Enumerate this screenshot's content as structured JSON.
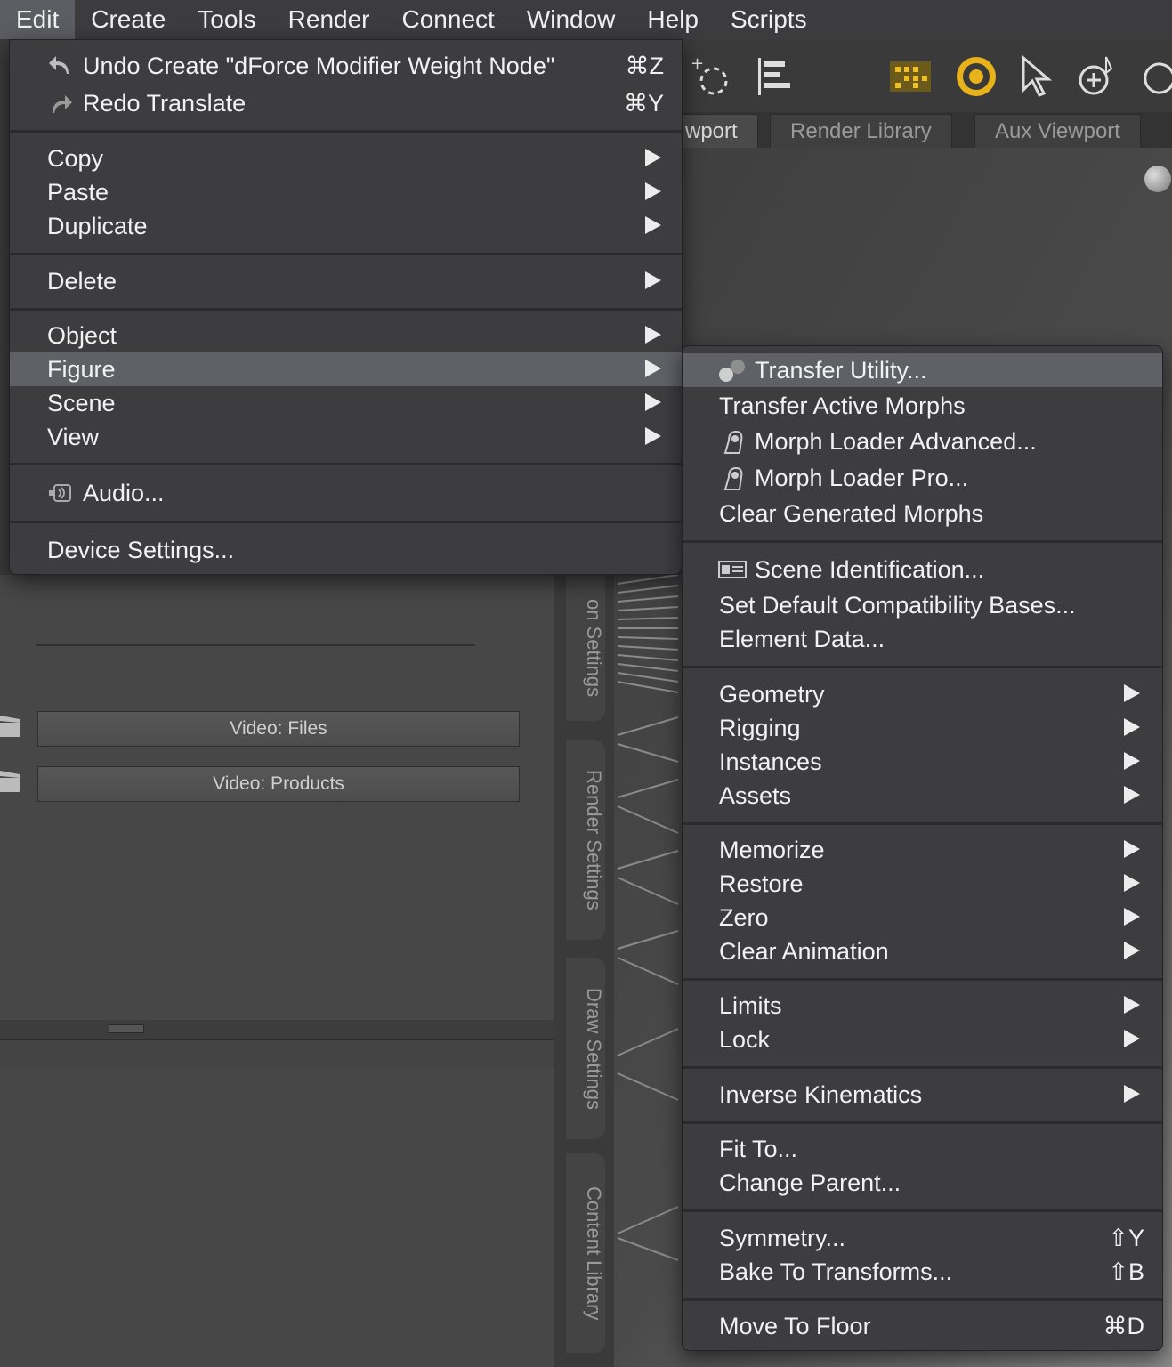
{
  "menubar": {
    "items": [
      "Edit",
      "Create",
      "Tools",
      "Render",
      "Connect",
      "Window",
      "Help",
      "Scripts"
    ],
    "active": "Edit"
  },
  "tabs": {
    "partial": "wport",
    "render_library": "Render Library",
    "aux_viewport": "Aux Viewport"
  },
  "left_panel": {
    "video_files": "Video: Files",
    "video_products": "Video:  Products"
  },
  "side_tabs": {
    "partial": "on Settings",
    "render_settings": "Render Settings",
    "draw_settings": "Draw Settings",
    "content_library": "Content Library"
  },
  "edit_menu": {
    "undo": {
      "label": "Undo Create \"dForce Modifier Weight Node\"",
      "shortcut": "⌘Z"
    },
    "redo": {
      "label": "Redo Translate",
      "shortcut": "⌘Y"
    },
    "copy": "Copy",
    "paste": "Paste",
    "duplicate": "Duplicate",
    "delete": "Delete",
    "object": "Object",
    "figure": "Figure",
    "scene": "Scene",
    "view": "View",
    "audio": "Audio...",
    "device_settings": "Device Settings..."
  },
  "figure_menu": {
    "transfer_utility": "Transfer Utility...",
    "transfer_active_morphs": "Transfer Active Morphs",
    "morph_loader_advanced": "Morph Loader Advanced...",
    "morph_loader_pro": "Morph Loader Pro...",
    "clear_generated_morphs": "Clear Generated Morphs",
    "scene_identification": "Scene Identification...",
    "set_default_compat": "Set Default Compatibility Bases...",
    "element_data": "Element Data...",
    "geometry": "Geometry",
    "rigging": "Rigging",
    "instances": "Instances",
    "assets": "Assets",
    "memorize": "Memorize",
    "restore": "Restore",
    "zero": "Zero",
    "clear_animation": "Clear Animation",
    "limits": "Limits",
    "lock": "Lock",
    "inverse_kinematics": "Inverse Kinematics",
    "fit_to": "Fit To...",
    "change_parent": "Change Parent...",
    "symmetry": {
      "label": "Symmetry...",
      "shortcut": "⇧Y"
    },
    "bake_to_transforms": {
      "label": "Bake To Transforms...",
      "shortcut": "⇧B"
    },
    "move_to_floor": {
      "label": "Move To Floor",
      "shortcut": "⌘D"
    }
  }
}
